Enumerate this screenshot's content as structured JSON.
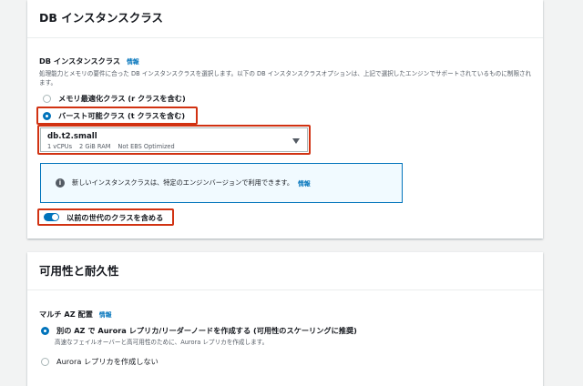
{
  "instance_panel": {
    "title": "DB インスタンスクラス",
    "field_label": "DB インスタンスクラス",
    "info_link": "情報",
    "description": "処理能力とメモリの要件に合った DB インスタンスクラスを選択します。以下の DB インスタンスクラスオプションは、上記で選択したエンジンでサポートされているものに制限されます。",
    "options": [
      {
        "label": "メモリ最適化クラス (r クラスを含む)",
        "checked": false
      },
      {
        "label": "バースト可能クラス (t クラスを含む)",
        "checked": true
      }
    ],
    "select": {
      "value": "db.t2.small",
      "vcpus": "1 vCPUs",
      "ram": "2 GiB RAM",
      "ebs": "Not EBS Optimized"
    },
    "alert": {
      "text": "新しいインスタンスクラスは、特定のエンジンバージョンで利用できます。",
      "link": "情報"
    },
    "toggle": {
      "label": "以前の世代のクラスを含める",
      "on": true
    }
  },
  "availability_panel": {
    "title": "可用性と耐久性",
    "field_label": "マルチ AZ 配置",
    "info_link": "情報",
    "options": [
      {
        "label": "別の AZ で Aurora レプリカ/リーダーノードを作成する (可用性のスケーリングに推奨)",
        "description": "高速なフェイルオーバーと高可用性のために、Aurora レプリカを作成します。",
        "checked": true
      },
      {
        "label": "Aurora レプリカを作成しない",
        "checked": false
      }
    ]
  },
  "colors": {
    "accent": "#0073bb",
    "highlight": "#d13212"
  }
}
